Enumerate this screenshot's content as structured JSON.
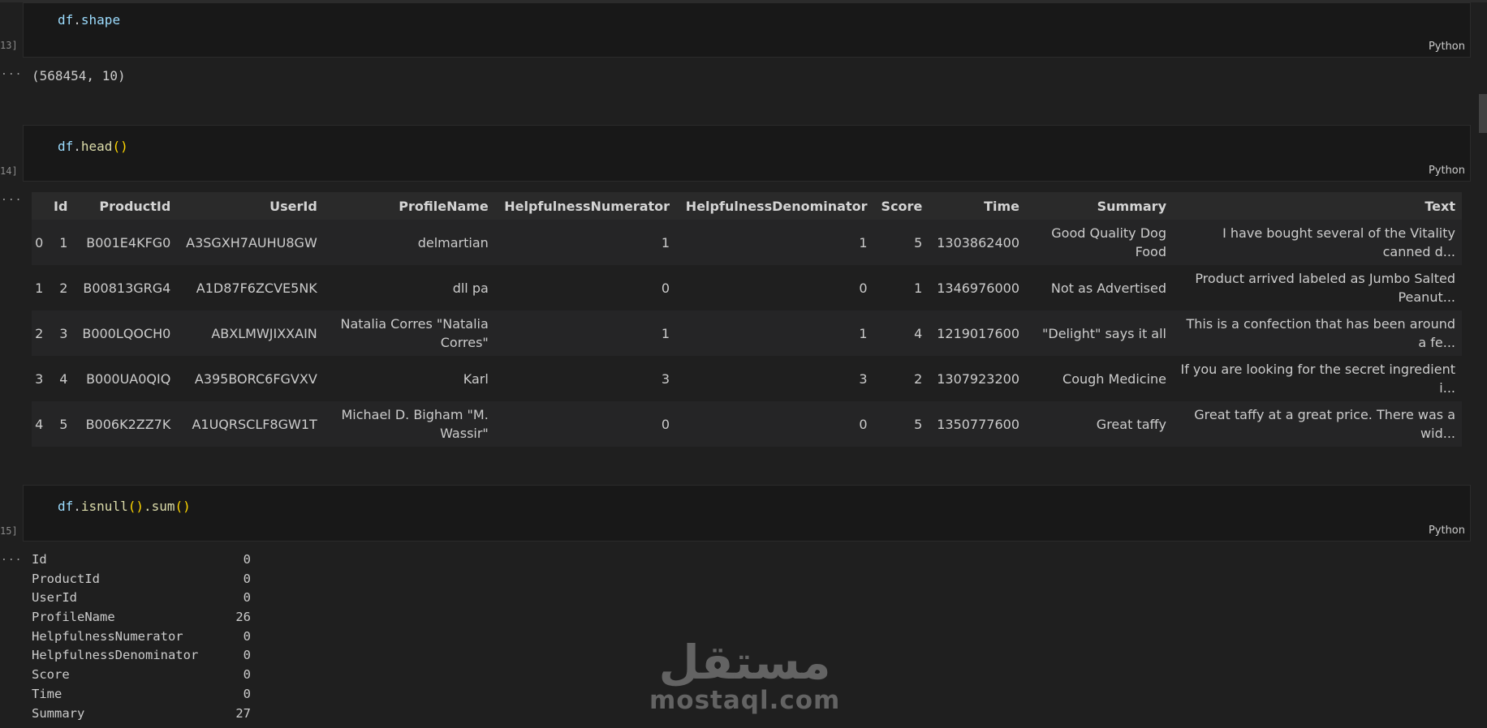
{
  "cells": [
    {
      "exec": "13]",
      "code": [
        "df",
        ".",
        "shape",
        "",
        "",
        ""
      ],
      "lang": "Python"
    },
    {
      "exec": "14]",
      "code": [
        "df",
        ".",
        "head",
        "()",
        "",
        ""
      ],
      "lang": "Python"
    },
    {
      "exec": "15]",
      "code": [
        "df",
        ".",
        "isnull",
        "()",
        ".sum",
        "()"
      ],
      "lang": "Python"
    }
  ],
  "output_indicator": "...",
  "shape_output": "(568454, 10)",
  "table": {
    "columns": [
      "",
      "Id",
      "ProductId",
      "UserId",
      "ProfileName",
      "HelpfulnessNumerator",
      "HelpfulnessDenominator",
      "Score",
      "Time",
      "Summary",
      "Text"
    ],
    "rows": [
      [
        "0",
        "1",
        "B001E4KFG0",
        "A3SGXH7AUHU8GW",
        "delmartian",
        "1",
        "1",
        "5",
        "1303862400",
        "Good Quality Dog Food",
        "I have bought several of the Vitality canned d..."
      ],
      [
        "1",
        "2",
        "B00813GRG4",
        "A1D87F6ZCVE5NK",
        "dll pa",
        "0",
        "0",
        "1",
        "1346976000",
        "Not as Advertised",
        "Product arrived labeled as Jumbo Salted Peanut..."
      ],
      [
        "2",
        "3",
        "B000LQOCH0",
        "ABXLMWJIXXAIN",
        "Natalia Corres \"Natalia Corres\"",
        "1",
        "1",
        "4",
        "1219017600",
        "\"Delight\" says it all",
        "This is a confection that has been around a fe..."
      ],
      [
        "3",
        "4",
        "B000UA0QIQ",
        "A395BORC6FGVXV",
        "Karl",
        "3",
        "3",
        "2",
        "1307923200",
        "Cough Medicine",
        "If you are looking for the secret ingredient i..."
      ],
      [
        "4",
        "5",
        "B006K2ZZ7K",
        "A1UQRSCLF8GW1T",
        "Michael D. Bigham \"M. Wassir\"",
        "0",
        "0",
        "5",
        "1350777600",
        "Great taffy",
        "Great taffy at a great price. There was a wid..."
      ]
    ]
  },
  "null_counts": [
    {
      "name": "Id",
      "count": "0"
    },
    {
      "name": "ProductId",
      "count": "0"
    },
    {
      "name": "UserId",
      "count": "0"
    },
    {
      "name": "ProfileName",
      "count": "26"
    },
    {
      "name": "HelpfulnessNumerator",
      "count": "0"
    },
    {
      "name": "HelpfulnessDenominator",
      "count": "0"
    },
    {
      "name": "Score",
      "count": "0"
    },
    {
      "name": "Time",
      "count": "0"
    },
    {
      "name": "Summary",
      "count": "27"
    }
  ],
  "watermark": {
    "arabic": "مستقل",
    "latin": "mostaql.com"
  }
}
